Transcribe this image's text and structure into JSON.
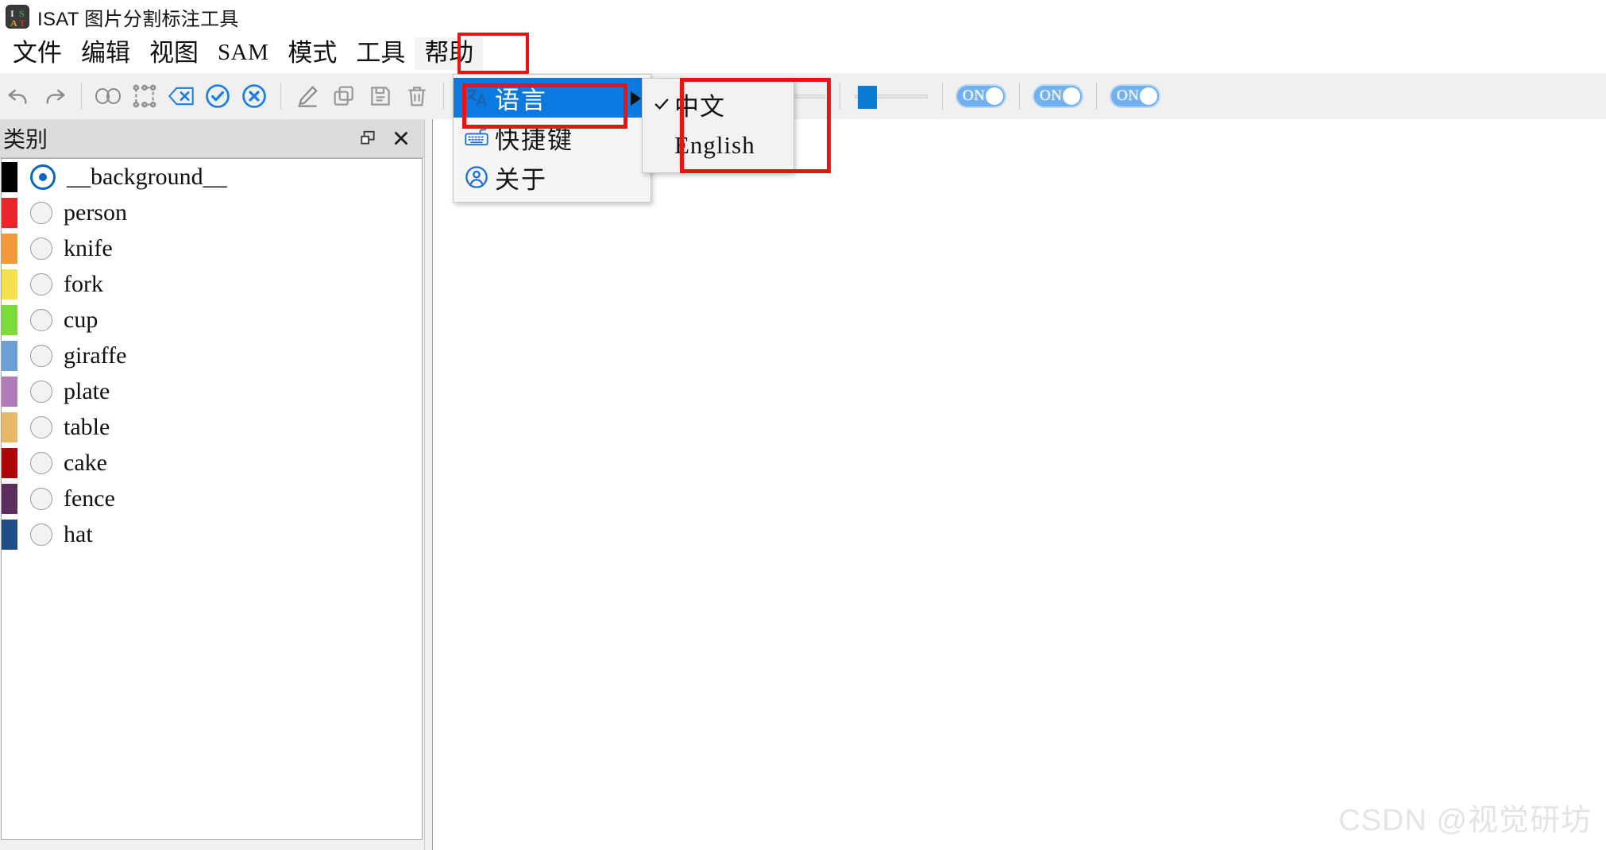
{
  "window": {
    "title": "ISAT 图片分割标注工具",
    "app_icon_letters": [
      "I",
      "S",
      "A",
      "T"
    ]
  },
  "menubar": {
    "items": [
      {
        "label": "文件",
        "name": "menu-file"
      },
      {
        "label": "编辑",
        "name": "menu-edit"
      },
      {
        "label": "视图",
        "name": "menu-view"
      },
      {
        "label": "SAM",
        "name": "menu-sam"
      },
      {
        "label": "模式",
        "name": "menu-mode"
      },
      {
        "label": "工具",
        "name": "menu-tools"
      },
      {
        "label": "帮助",
        "name": "menu-help"
      }
    ],
    "active": "帮助",
    "highlight_color": "#ee1111"
  },
  "toolbar": {
    "buttons": [
      {
        "name": "undo-icon",
        "title": "撤销"
      },
      {
        "name": "redo-icon",
        "title": "重做"
      },
      {
        "name": "sam-infinity-icon",
        "title": "SAM"
      },
      {
        "name": "bbox-icon",
        "title": "框选"
      },
      {
        "name": "backspace-icon",
        "title": "退格"
      },
      {
        "name": "confirm-check-icon",
        "title": "确认"
      },
      {
        "name": "cancel-x-icon",
        "title": "取消"
      },
      {
        "name": "edit-pencil-icon",
        "title": "编辑"
      },
      {
        "name": "copy-icon",
        "title": "复制"
      },
      {
        "name": "save-icon",
        "title": "保存"
      },
      {
        "name": "delete-trash-icon",
        "title": "删除"
      },
      {
        "name": "prev-image-icon",
        "title": "上一张"
      },
      {
        "name": "next-image-icon",
        "title": "下一张"
      },
      {
        "name": "image-icon",
        "title": "图像"
      },
      {
        "name": "eye-visibility-icon",
        "title": "显示"
      }
    ],
    "sliders": [
      {
        "name": "slider-opacity",
        "value": 45
      },
      {
        "name": "slider-vertex",
        "value": 30
      },
      {
        "name": "slider-brightness",
        "value": 12
      }
    ],
    "toggles": [
      {
        "name": "toggle-1",
        "label": "ON",
        "state": "on"
      },
      {
        "name": "toggle-2",
        "label": "ON",
        "state": "on"
      },
      {
        "name": "toggle-3",
        "label": "ON",
        "state": "on"
      }
    ]
  },
  "sidebar": {
    "title": "类别",
    "float_button": "浮动",
    "close_button": "关闭",
    "categories": [
      {
        "label": "__background__",
        "color": "#000000",
        "selected": true
      },
      {
        "label": "person",
        "color": "#e8262b",
        "selected": false
      },
      {
        "label": "knife",
        "color": "#f29a3a",
        "selected": false
      },
      {
        "label": "fork",
        "color": "#f7e04f",
        "selected": false
      },
      {
        "label": "cup",
        "color": "#7ddb3a",
        "selected": false
      },
      {
        "label": "giraffe",
        "color": "#6d9fd4",
        "selected": false
      },
      {
        "label": "plate",
        "color": "#b07cb9",
        "selected": false
      },
      {
        "label": "table",
        "color": "#e8b869",
        "selected": false
      },
      {
        "label": "cake",
        "color": "#ae0606",
        "selected": false
      },
      {
        "label": "fence",
        "color": "#5c2e5c",
        "selected": false
      },
      {
        "label": "hat",
        "color": "#1f4e87",
        "selected": false
      }
    ]
  },
  "help_menu": {
    "items": [
      {
        "label": "语言",
        "name": "menu-item-language",
        "icon": "translate-icon",
        "selected": true,
        "has_submenu": true
      },
      {
        "label": "快捷键",
        "name": "menu-item-shortcuts",
        "icon": "keyboard-icon",
        "selected": false,
        "has_submenu": false
      },
      {
        "label": "关于",
        "name": "menu-item-about",
        "icon": "about-person-icon",
        "selected": false,
        "has_submenu": false
      }
    ]
  },
  "language_submenu": {
    "items": [
      {
        "label": "中文",
        "name": "language-option-chinese",
        "checked": true
      },
      {
        "label": "English",
        "name": "language-option-english",
        "checked": false
      }
    ]
  },
  "watermark": {
    "text": "CSDN @视觉研坊"
  }
}
